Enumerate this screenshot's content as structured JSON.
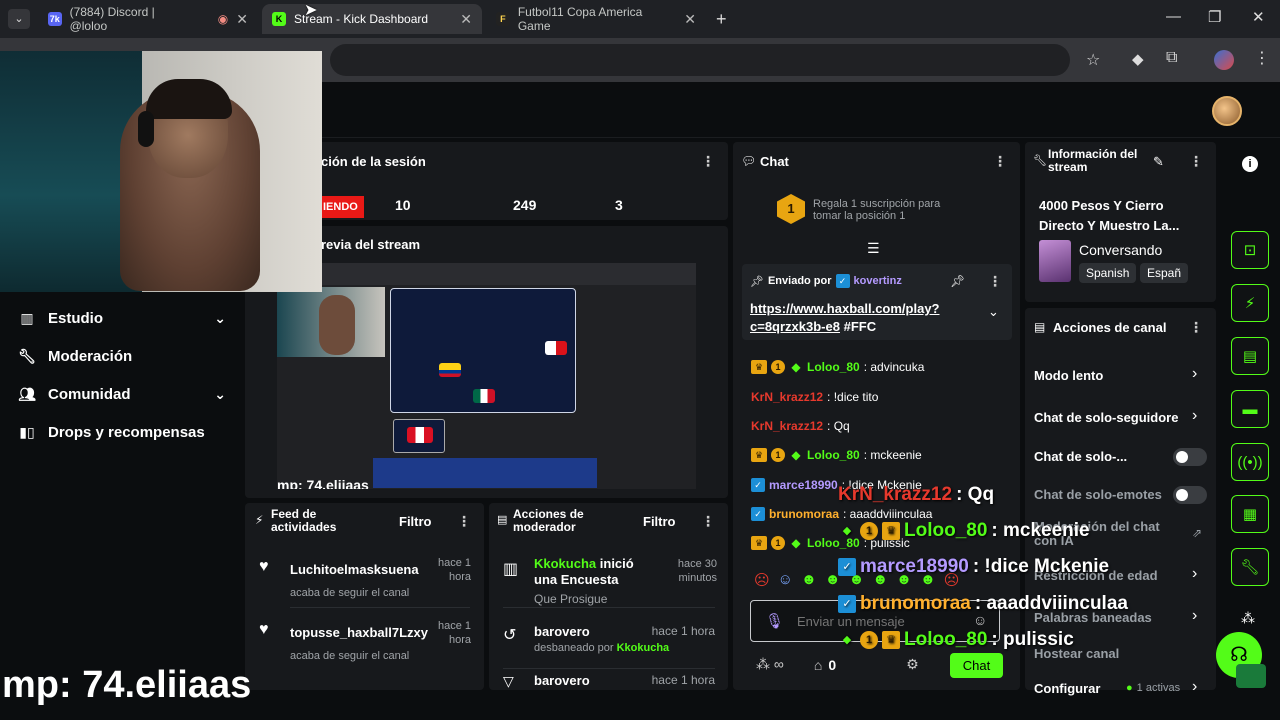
{
  "browser": {
    "tabs": [
      {
        "label": "(7884) Discord | @loloo"
      },
      {
        "label": "Stream - Kick Dashboard"
      },
      {
        "label": "Futbol11 Copa America Game"
      }
    ]
  },
  "session": {
    "title": "ción de la sesión",
    "live_label": "IENDO",
    "stats": [
      "10",
      "249",
      "3"
    ]
  },
  "preview": {
    "title": "revia del stream",
    "overlay_text": "mp: 74.eliiaas"
  },
  "webcam_overlay_text": "mp: 74.eliiaas",
  "sidebar": {
    "items": [
      {
        "label": "Estudio"
      },
      {
        "label": "Moderación"
      },
      {
        "label": "Comunidad"
      },
      {
        "label": "Drops y recompensas"
      }
    ]
  },
  "activity": {
    "title": "Feed de actividades",
    "filter": "Filtro",
    "items": [
      {
        "name": "Luchitoelmasksuena",
        "sub": "acaba de seguir el canal",
        "time": "hace 1 hora"
      },
      {
        "name": "topusse_haxball7Lzxy",
        "sub": "acaba de seguir el canal",
        "time": "hace 1 hora"
      }
    ]
  },
  "mod": {
    "title": "Acciones de moderador",
    "filter": "Filtro",
    "items": [
      {
        "user": "Kkokucha",
        "action": "inició una Encuesta",
        "sub": "Que Prosigue",
        "time": "hace 30 minutos"
      },
      {
        "user": "barovero",
        "sub_pre": "desbaneado por",
        "sub_user": "Kkokucha",
        "time": "hace 1 hora"
      },
      {
        "user": "barovero",
        "time": "hace 1 hora"
      }
    ]
  },
  "chat": {
    "title": "Chat",
    "gift_line1": "Regala 1 suscripción para",
    "gift_line2": "tomar la posición 1",
    "pinned_prefix": "Enviado por",
    "pinned_user": "kovertinz",
    "pinned_link1": "https://www.haxball.com/play?",
    "pinned_link2": "c=8qrzxk3b-e8",
    "pinned_tag": "#FFC",
    "messages": [
      {
        "user": "Loloo_80",
        "text": ": advincuka"
      },
      {
        "user": "KrN_krazz12",
        "text": ": !dice tito"
      },
      {
        "user": "KrN_krazz12",
        "text": ": Qq"
      },
      {
        "user": "Loloo_80",
        "text": ": mckeenie"
      },
      {
        "user": "marce18990",
        "text": ": !dice Mckenie"
      },
      {
        "user": "brunomoraa",
        "text": ": aaaddviiinculaa"
      },
      {
        "user": "Loloo_80",
        "text": ": pulissic"
      }
    ],
    "input_placeholder": "Enviar un mensaje",
    "send_label": "Chat",
    "count_label": "0"
  },
  "chat_overlay": [
    {
      "user": "KrN_krazz12",
      "text": ": Qq"
    },
    {
      "user": "Loloo_80",
      "text": ": mckeenie"
    },
    {
      "user": "marce18990",
      "text": ": !dice Mckenie"
    },
    {
      "user": "brunomoraa",
      "text": ": aaaddviiinculaa"
    },
    {
      "user": "Loloo_80",
      "text": ": pulissic"
    }
  ],
  "stream_info": {
    "title": "Información del stream",
    "stream_title": "4000 Pesos Y Cierro Directo Y Muestro La...",
    "category": "Conversando",
    "tags": [
      "Spanish",
      "Españ"
    ]
  },
  "channel_actions": {
    "title": "Acciones de canal",
    "items": [
      {
        "label": "Modo lento"
      },
      {
        "label": "Chat de solo-seguidore"
      },
      {
        "label": "Chat de solo-..."
      },
      {
        "label": "Chat de solo-emotes"
      },
      {
        "label": "Moderación del chat con IA"
      },
      {
        "label": "Restricción de edad"
      },
      {
        "label": "Palabras baneadas"
      },
      {
        "label": "Hostear canal"
      },
      {
        "label": "Configurar"
      }
    ],
    "active_count": "1 activas"
  },
  "colors": {
    "accent": "#53fc18",
    "live": "#e91916",
    "panel": "#17191c",
    "background": "#0b0d0f"
  }
}
